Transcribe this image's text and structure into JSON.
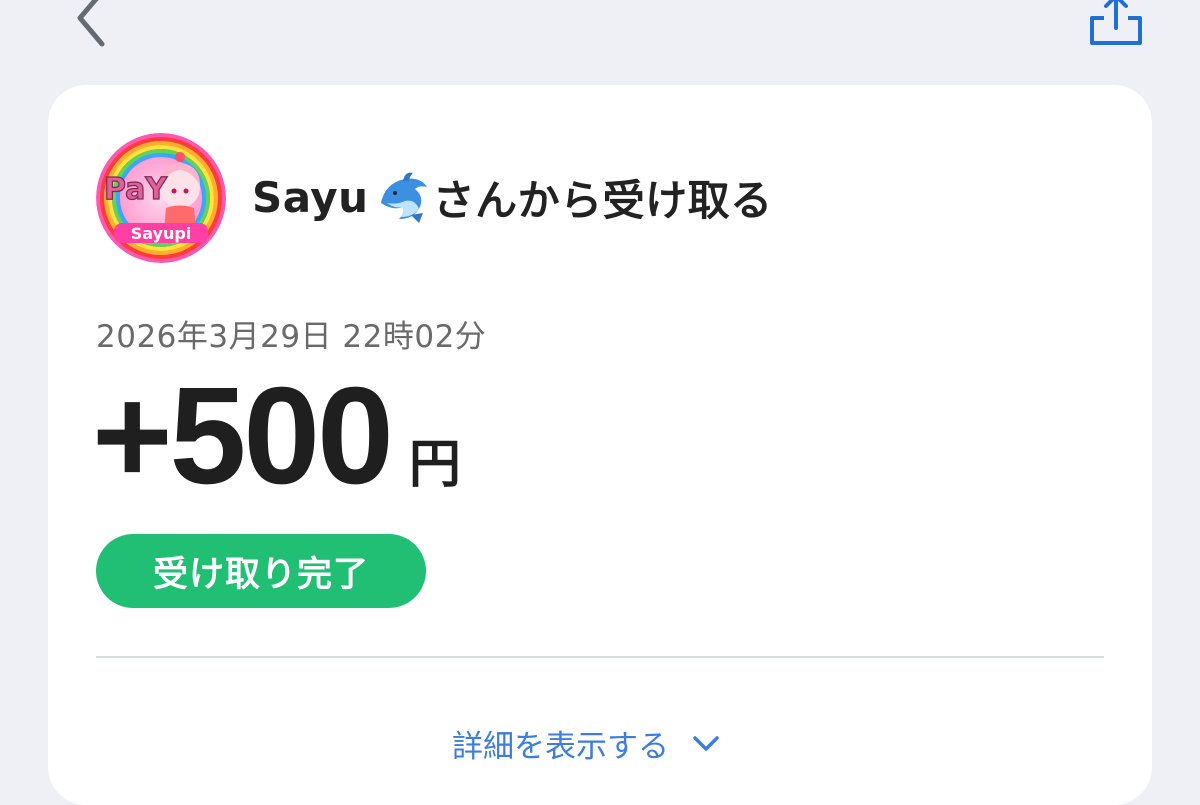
{
  "header": {
    "back_icon": "chevron-left-icon",
    "share_icon": "share-icon"
  },
  "transaction": {
    "avatar_text_top": "PaY",
    "avatar_text_bottom": "Sayupi",
    "sender_name": "Sayu",
    "sender_emoji": "dolphin",
    "title_suffix": "さんから受け取る",
    "datetime": "2026年3月29日 22時02分",
    "amount": "+500",
    "currency": "円",
    "status": "受け取り完了",
    "details_label": "詳細を表示する"
  },
  "colors": {
    "background": "#eef0f5",
    "accent_blue": "#3d7de0",
    "status_green": "#21bf73",
    "text_primary": "#1f1f1f",
    "text_secondary": "#6a6a6a"
  }
}
